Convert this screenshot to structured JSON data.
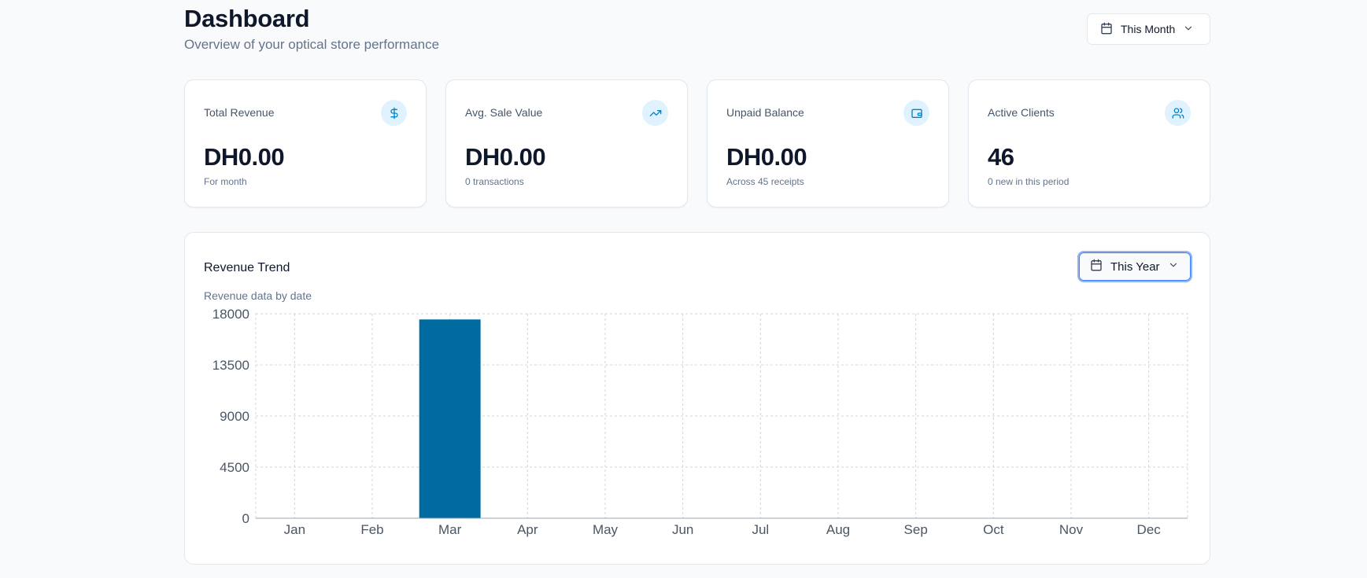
{
  "header": {
    "title": "Dashboard",
    "subtitle": "Overview of your optical store performance",
    "period_label": "This Month"
  },
  "cards": [
    {
      "title": "Total Revenue",
      "value": "DH0.00",
      "note": "For month",
      "icon": "dollar-icon"
    },
    {
      "title": "Avg. Sale Value",
      "value": "DH0.00",
      "note": "0 transactions",
      "icon": "trending-up-icon"
    },
    {
      "title": "Unpaid Balance",
      "value": "DH0.00",
      "note": "Across 45 receipts",
      "icon": "wallet-icon"
    },
    {
      "title": "Active Clients",
      "value": "46",
      "note": "0 new in this period",
      "icon": "users-icon"
    }
  ],
  "revenue_trend": {
    "title": "Revenue Trend",
    "subtitle": "Revenue data by date",
    "period_label": "This Year"
  },
  "colors": {
    "accent": "#0369a1",
    "icon_bg": "#e0f2fe",
    "grid": "#d1d5db"
  },
  "chart_data": {
    "type": "bar",
    "categories": [
      "Jan",
      "Feb",
      "Mar",
      "Apr",
      "May",
      "Jun",
      "Jul",
      "Aug",
      "Sep",
      "Oct",
      "Nov",
      "Dec"
    ],
    "values": [
      0,
      0,
      17500,
      0,
      0,
      0,
      0,
      0,
      0,
      0,
      0,
      0
    ],
    "yticks": [
      0,
      4500,
      9000,
      13500,
      18000
    ],
    "ylim": [
      0,
      18000
    ],
    "grid": true,
    "color": "#006ba1"
  }
}
